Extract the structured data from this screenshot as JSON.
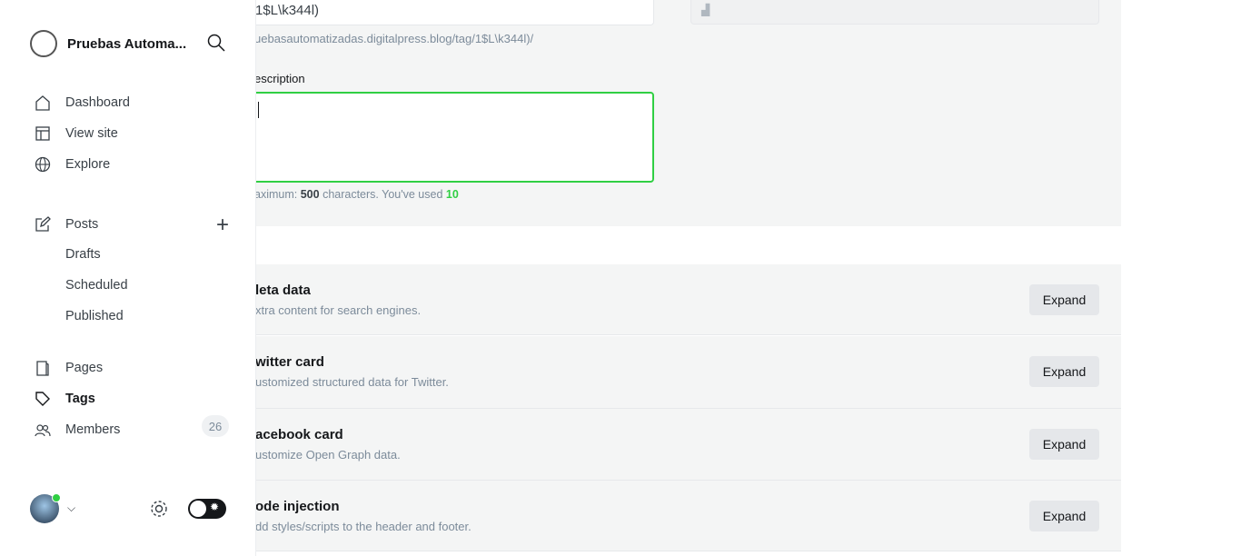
{
  "form": {
    "slug_value": "1$L\\k344l)",
    "url_preview": "uebasautomatizadas.digitalpress.blog/tag/1$L\\k344l)/",
    "description_label": "escription",
    "hint_prefix": "aximum:",
    "hint_max": "500",
    "hint_mid": "characters. You've used",
    "hint_used": "10",
    "upload_icon": "upload-icon"
  },
  "sections": [
    {
      "title": "leta data",
      "desc": "xtra content for search engines.",
      "button": "Expand"
    },
    {
      "title": "witter card",
      "desc": "ustomized structured data for Twitter.",
      "button": "Expand"
    },
    {
      "title": "acebook card",
      "desc": "ustomize Open Graph data.",
      "button": "Expand"
    },
    {
      "title": "ode injection",
      "desc": "dd styles/scripts to the header and footer.",
      "button": "Expand"
    }
  ],
  "sidebar": {
    "site_title": "Pruebas Automa...",
    "items": [
      {
        "label": "Dashboard"
      },
      {
        "label": "View site"
      },
      {
        "label": "Explore"
      },
      {
        "label": "Posts"
      },
      {
        "label": "Drafts"
      },
      {
        "label": "Scheduled"
      },
      {
        "label": "Published"
      },
      {
        "label": "Pages"
      },
      {
        "label": "Tags"
      },
      {
        "label": "Members",
        "count": "26"
      }
    ]
  },
  "colors": {
    "accent": "#30cf43",
    "panel": "#f4f5f5"
  }
}
